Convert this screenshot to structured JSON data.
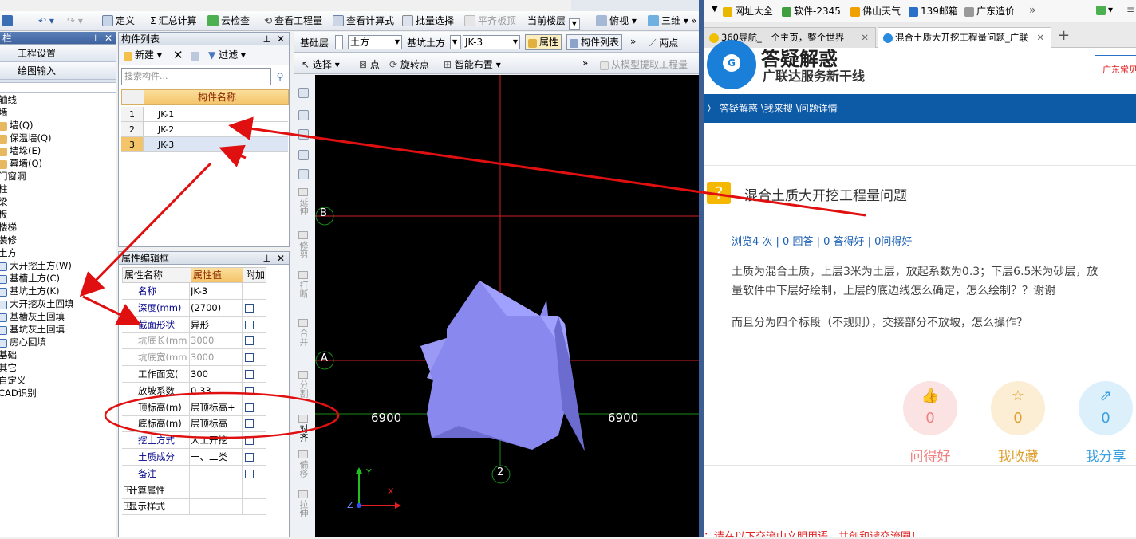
{
  "app": {
    "toolbar1": {
      "define": "定义",
      "sum_calc": "汇总计算",
      "cloud_check": "云检查",
      "view_quantity": "查看工程量",
      "view_formula": "查看计算式",
      "batch_select": "批量选择",
      "level_slab": "平齐板顶",
      "current_floor": "当前楼层",
      "top_view": "俯视",
      "three_d": "三维"
    },
    "toolbar2": {
      "floor": "基础层",
      "category": "土方",
      "type": "基坑土方",
      "component": "JK-3",
      "properties": "属性",
      "component_list": "构件列表",
      "two_points": "两点",
      "select": "选择",
      "point": "点",
      "rotate_point": "旋转点",
      "smart_layout": "智能布置",
      "extract": "从模型提取工程量"
    },
    "left_panel": {
      "title": "栏",
      "project_settings": "工程设置",
      "drawing_input": "绘图输入",
      "tree": [
        {
          "label": "轴线",
          "indent": 0
        },
        {
          "label": "墙",
          "indent": 0
        },
        {
          "label": "墙(Q)",
          "indent": 1
        },
        {
          "label": "保温墙(Q)",
          "indent": 1
        },
        {
          "label": "墙垛(E)",
          "indent": 1
        },
        {
          "label": "幕墙(Q)",
          "indent": 1
        },
        {
          "label": "门窗洞",
          "indent": 0
        },
        {
          "label": "柱",
          "indent": 0
        },
        {
          "label": "梁",
          "indent": 0
        },
        {
          "label": "板",
          "indent": 0
        },
        {
          "label": "楼梯",
          "indent": 0
        },
        {
          "label": "装修",
          "indent": 0
        },
        {
          "label": "土方",
          "indent": 0
        },
        {
          "label": "大开挖土方(W)",
          "indent": 1
        },
        {
          "label": "基槽土方(C)",
          "indent": 1
        },
        {
          "label": "基坑土方(K)",
          "indent": 1
        },
        {
          "label": "大开挖灰土回填",
          "indent": 1
        },
        {
          "label": "基槽灰土回填",
          "indent": 1
        },
        {
          "label": "基坑灰土回填",
          "indent": 1
        },
        {
          "label": "房心回填",
          "indent": 1
        },
        {
          "label": "基础",
          "indent": 0
        },
        {
          "label": "其它",
          "indent": 0
        },
        {
          "label": "自定义",
          "indent": 0
        },
        {
          "label": "CAD识别",
          "indent": 0
        }
      ]
    },
    "component_list": {
      "title": "构件列表",
      "new": "新建",
      "filter": "过滤",
      "search_placeholder": "搜索构件...",
      "column": "构件名称",
      "rows": [
        {
          "num": "1",
          "name": "JK-1"
        },
        {
          "num": "2",
          "name": "JK-2"
        },
        {
          "num": "3",
          "name": "JK-3"
        }
      ]
    },
    "property_editor": {
      "title": "属性编辑框",
      "col_name": "属性名称",
      "col_value": "属性值",
      "col_extra": "附加",
      "rows": [
        {
          "name": "名称",
          "value": "JK-3",
          "check": false
        },
        {
          "name": "深度(mm)",
          "value": "(2700)",
          "check": true
        },
        {
          "name": "截面形状",
          "value": "异形",
          "check": true
        },
        {
          "name": "坑底长(mm)",
          "value": "3000",
          "check": true
        },
        {
          "name": "坑底宽(mm)",
          "value": "3000",
          "check": true
        },
        {
          "name": "工作面宽(",
          "value": "300",
          "check": true
        },
        {
          "name": "放坡系数",
          "value": "0.33",
          "check": true
        },
        {
          "name": "顶标高(m)",
          "value": "层顶标高+",
          "check": true
        },
        {
          "name": "底标高(m)",
          "value": "层顶标高",
          "check": true
        },
        {
          "name": "挖土方式",
          "value": "人工开挖",
          "check": true
        },
        {
          "name": "土质成分",
          "value": "一、二类",
          "check": true
        },
        {
          "name": "备注",
          "value": "",
          "check": true
        },
        {
          "name": "计算属性",
          "value": "",
          "check": false
        },
        {
          "name": "显示样式",
          "value": "",
          "check": false
        }
      ]
    },
    "vertical_tools": [
      "延伸",
      "修剪",
      "打断",
      "合并",
      "分割",
      "对齐",
      "偏移",
      "拉伸"
    ],
    "canvas": {
      "axis_b": "B",
      "axis_a": "A",
      "axis_2": "2",
      "dim_left": "6900",
      "dim_right": "6900",
      "x_label": "X",
      "y_label": "Y",
      "z_label": "Z"
    }
  },
  "browser": {
    "bookmarks": [
      "网址大全",
      "软件-2345",
      "佛山天气",
      "139邮箱",
      "广东造价"
    ],
    "tabs": [
      {
        "label": "360导航_一个主页，整个世界"
      },
      {
        "label": "混合土质大开挖工程量问题_广联"
      }
    ],
    "site": {
      "logo_title": "答疑解惑",
      "logo_sub": "广联达服务新干线",
      "corner_text": "广东常见",
      "breadcrumb": "答疑解惑 \\我来搜 \\问题详情"
    },
    "question": {
      "title": "混合土质大开挖工程量问题",
      "meta": "浏览4 次 | 0 回答 | 0 答得好 | 0问得好",
      "body1": "土质为混合土质，上层3米为土层，放起系数为0.3；下层6.5米为砂层，放",
      "body2": "量软件中下层好绘制，上层的底边线怎么确定，怎么绘制？？谢谢",
      "body3": "而且分为四个标段（不规则），交接部分不放坡，怎么操作？",
      "stats": [
        {
          "label": "问得好",
          "count": "0",
          "color": "#f08080"
        },
        {
          "label": "我收藏",
          "count": "0",
          "color": "#e0a030"
        },
        {
          "label": "我分享",
          "count": "0",
          "color": "#3aa0e0"
        }
      ],
      "footer_notice": "：请在以下交流中文明用语，共创和谐交流圈！"
    }
  }
}
